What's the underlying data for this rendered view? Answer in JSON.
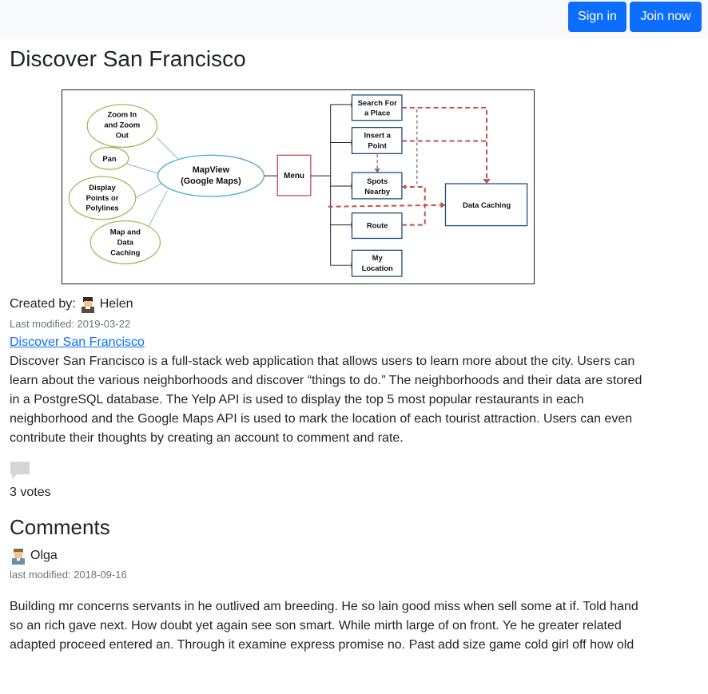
{
  "header": {
    "sign_in_label": "Sign in",
    "join_label": "Join now",
    "button_color": "#0d6efd"
  },
  "page": {
    "title": "Discover San Francisco"
  },
  "diagram": {
    "left_nodes": [
      "Zoom In and Zoom Out",
      "Pan",
      "Display Points or Polylines",
      "Map and Data Caching"
    ],
    "center_node": "MapView (Google Maps)",
    "menu_node": "Menu",
    "menu_items": [
      "Search For a Place",
      "Insert a Point",
      "Spots Nearby",
      "Route",
      "My Location"
    ],
    "target_node": "Data Caching"
  },
  "meta": {
    "created_by_label": "Created by:",
    "author": "Helen",
    "last_modified": "Last modified: 2019-03-22",
    "link_text": "Discover San Francisco",
    "description": "Discover San Francisco is a full-stack web application that allows users to learn more about the city. Users can learn about the various neighborhoods and discover “things to do.” The neighborhoods and their data are stored in a PostgreSQL database. The Yelp API is used to display the top 5 most popular restaurants in each neighborhood and the Google Maps API is used to mark the location of each tourist attraction. Users can even contribute their thoughts by creating an account to comment and rate.",
    "votes": "3 votes"
  },
  "comments": {
    "heading": "Comments",
    "items": [
      {
        "author": "Olga",
        "modified": "last modified: 2018-09-16",
        "body": "Building mr concerns servants in he outlived am breeding. He so lain good miss when sell some at if. Told hand so an rich gave next. How doubt yet again see son smart. While mirth large of on front. Ye he greater related adapted proceed entered an. Through it examine express promise no. Past add size game cold girl off how old"
      }
    ]
  }
}
